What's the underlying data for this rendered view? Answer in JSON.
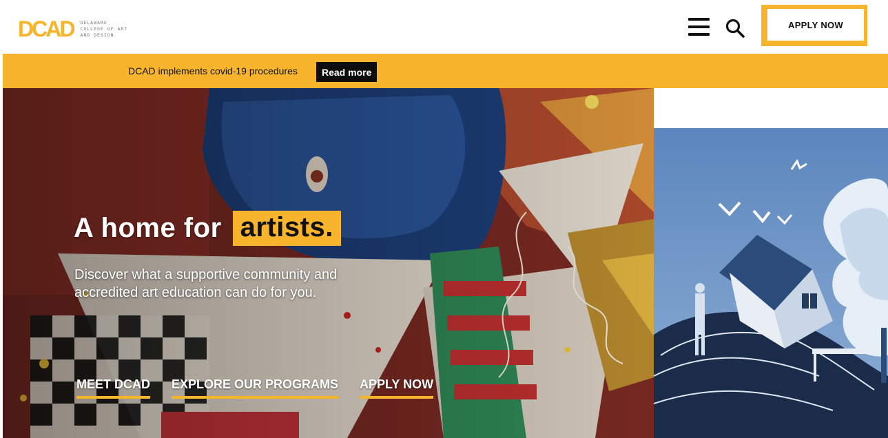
{
  "header": {
    "logo_mark": "DCAD",
    "logo_lines": [
      "DELAWARE",
      "COLLEGE OF ART",
      "AND DESIGN"
    ],
    "menu_icon": "hamburger-menu-icon",
    "search_icon": "search-icon",
    "apply_label": "APPLY NOW"
  },
  "alert": {
    "text": "DCAD implements covid-19 procedures",
    "button_label": "Read more"
  },
  "hero": {
    "headline": "A home for",
    "headline_highlight": "artists.",
    "subtitle": "Discover what a supportive community and accredited art education can do for you.",
    "links": [
      "MEET DCAD",
      "EXPLORE OUR PROGRAMS",
      "APPLY NOW"
    ]
  },
  "colors": {
    "accent": "#f7b42c",
    "dark": "#111111",
    "white": "#ffffff"
  }
}
